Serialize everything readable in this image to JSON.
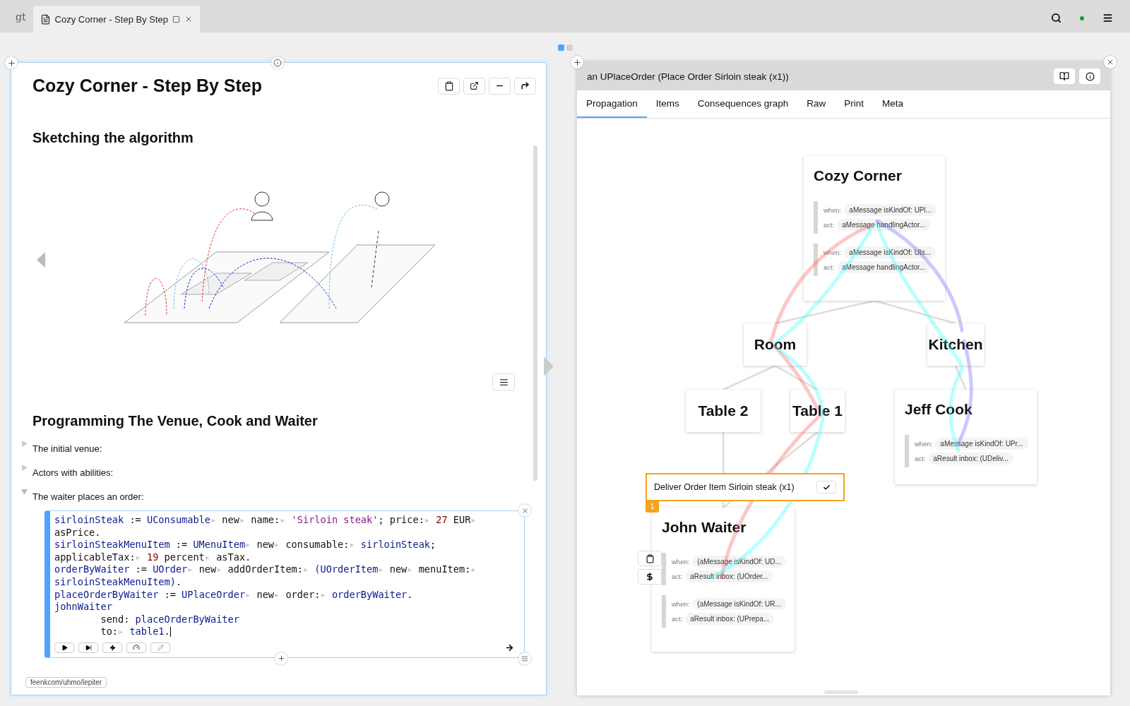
{
  "topbar": {
    "logo": "gt",
    "tabs": [
      {
        "title": "Cozy Corner - Step By Step",
        "selected": true
      }
    ]
  },
  "pager": [
    {
      "selected": true
    },
    {
      "selected": false
    }
  ],
  "page": {
    "title": "Cozy Corner - Step By Step",
    "sketch_heading": "Sketching the algorithm",
    "sketch": {
      "kind": "picture"
    },
    "programming_heading": "Programming The Venue, Cook and Waiter",
    "items": [
      {
        "label": "The initial venue:",
        "expanded": false
      },
      {
        "label": "Actors with abilities:",
        "expanded": false
      },
      {
        "label": "The waiter places an order:",
        "expanded": true
      }
    ],
    "code": [
      [
        {
          "kind": "var",
          "t": "sirloinSteak"
        },
        {
          "kind": "plain",
          "t": " := "
        },
        {
          "kind": "var",
          "t": "UConsumable"
        },
        {
          "kind": "marker",
          "t": "▸"
        },
        {
          "kind": "plain",
          "t": " new"
        },
        {
          "kind": "marker",
          "t": "▸"
        },
        {
          "kind": "plain",
          "t": " name:"
        },
        {
          "kind": "marker",
          "t": "▸"
        },
        {
          "kind": "str",
          "t": " 'Sirloin steak'"
        },
        {
          "kind": "plain",
          "t": "; price:"
        },
        {
          "kind": "marker",
          "t": "▸"
        },
        {
          "kind": "num",
          "t": " 27"
        },
        {
          "kind": "plain",
          "t": " EUR"
        },
        {
          "kind": "marker",
          "t": "▸"
        }
      ],
      [
        {
          "kind": "plain",
          "t": "asPrice."
        }
      ],
      [
        {
          "kind": "var",
          "t": "sirloinSteakMenuItem"
        },
        {
          "kind": "plain",
          "t": " := "
        },
        {
          "kind": "var",
          "t": "UMenuItem"
        },
        {
          "kind": "marker",
          "t": "▸"
        },
        {
          "kind": "plain",
          "t": " new"
        },
        {
          "kind": "marker",
          "t": "▸"
        },
        {
          "kind": "plain",
          "t": " consumable:"
        },
        {
          "kind": "marker",
          "t": "▸"
        },
        {
          "kind": "var",
          "t": " sirloinSteak"
        },
        {
          "kind": "plain",
          "t": ";"
        }
      ],
      [
        {
          "kind": "plain",
          "t": "applicableTax:"
        },
        {
          "kind": "marker",
          "t": "▸"
        },
        {
          "kind": "num",
          "t": " 19"
        },
        {
          "kind": "plain",
          "t": " percent"
        },
        {
          "kind": "marker",
          "t": "▸"
        },
        {
          "kind": "plain",
          "t": " asTax."
        }
      ],
      [
        {
          "kind": "var",
          "t": "orderByWaiter"
        },
        {
          "kind": "plain",
          "t": " := "
        },
        {
          "kind": "var",
          "t": "UOrder"
        },
        {
          "kind": "marker",
          "t": "▸"
        },
        {
          "kind": "plain",
          "t": " new"
        },
        {
          "kind": "marker",
          "t": "▸"
        },
        {
          "kind": "plain",
          "t": " addOrderItem:"
        },
        {
          "kind": "marker",
          "t": "▸"
        },
        {
          "kind": "var",
          "t": " (UOrderItem"
        },
        {
          "kind": "marker",
          "t": "▸"
        },
        {
          "kind": "plain",
          "t": " new"
        },
        {
          "kind": "marker",
          "t": "▸"
        },
        {
          "kind": "plain",
          "t": " menuItem:"
        },
        {
          "kind": "marker",
          "t": "▸"
        }
      ],
      [
        {
          "kind": "var",
          "t": "sirloinSteakMenuItem)"
        },
        {
          "kind": "plain",
          "t": "."
        }
      ],
      [
        {
          "kind": "var",
          "t": "placeOrderByWaiter"
        },
        {
          "kind": "plain",
          "t": " := "
        },
        {
          "kind": "var",
          "t": "UPlaceOrder"
        },
        {
          "kind": "marker",
          "t": "▸"
        },
        {
          "kind": "plain",
          "t": " new"
        },
        {
          "kind": "marker",
          "t": "▸"
        },
        {
          "kind": "plain",
          "t": " order:"
        },
        {
          "kind": "marker",
          "t": "▸"
        },
        {
          "kind": "var",
          "t": " orderByWaiter"
        },
        {
          "kind": "plain",
          "t": "."
        }
      ],
      [
        {
          "kind": "var",
          "t": "johnWaiter"
        }
      ],
      [
        {
          "kind": "plain",
          "t": "        send: "
        },
        {
          "kind": "var",
          "t": "placeOrderByWaiter"
        }
      ],
      [
        {
          "kind": "plain",
          "t": "        to:"
        },
        {
          "kind": "marker",
          "t": "▸"
        },
        {
          "kind": "var",
          "t": " table1"
        },
        {
          "kind": "plain",
          "t": "."
        }
      ]
    ],
    "footer_tag": "feenkcom/uhmo/lepiter"
  },
  "inspector": {
    "title": "an UPlaceOrder (Place Order Sirloin steak (x1))",
    "tabs": [
      {
        "label": "Propagation",
        "selected": true
      },
      {
        "label": "Items",
        "selected": false
      },
      {
        "label": "Consequences graph",
        "selected": false
      },
      {
        "label": "Raw",
        "selected": false
      },
      {
        "label": "Print",
        "selected": false
      },
      {
        "label": "Meta",
        "selected": false
      }
    ],
    "nodes": [
      {
        "name": "Cozy Corner",
        "rules": [
          {
            "when_label": "when:",
            "when": "aMessage isKindOf: UPl...",
            "act_label": "act:",
            "act": "aMessage handlingActor..."
          },
          {
            "when_label": "when:",
            "when": "aMessage isKindOf: UIs...",
            "act_label": "act:",
            "act": "aMessage handlingActor..."
          }
        ]
      },
      {
        "name": "Room"
      },
      {
        "name": "Kitchen"
      },
      {
        "name": "Table 2"
      },
      {
        "name": "Table 1"
      },
      {
        "name": "Jeff Cook",
        "rules": [
          {
            "when_label": "when:",
            "when": "aMessage isKindOf: UPr...",
            "act_label": "act:",
            "act": "aResult inbox: (UDeliv..."
          }
        ]
      },
      {
        "name": "John Waiter",
        "rules": [
          {
            "when_label": "when:",
            "when": "(aMessage isKindOf: UD...",
            "act_label": "act:",
            "act": "aResult inbox: (UOrder..."
          },
          {
            "when_label": "when:",
            "when": "(aMessage isKindOf: UR...",
            "act_label": "act:",
            "act": "aResult inbox: (UPrepa..."
          }
        ]
      }
    ],
    "popup": {
      "label": "Deliver Order Item Sirloin steak (x1)",
      "badge": "1"
    }
  }
}
